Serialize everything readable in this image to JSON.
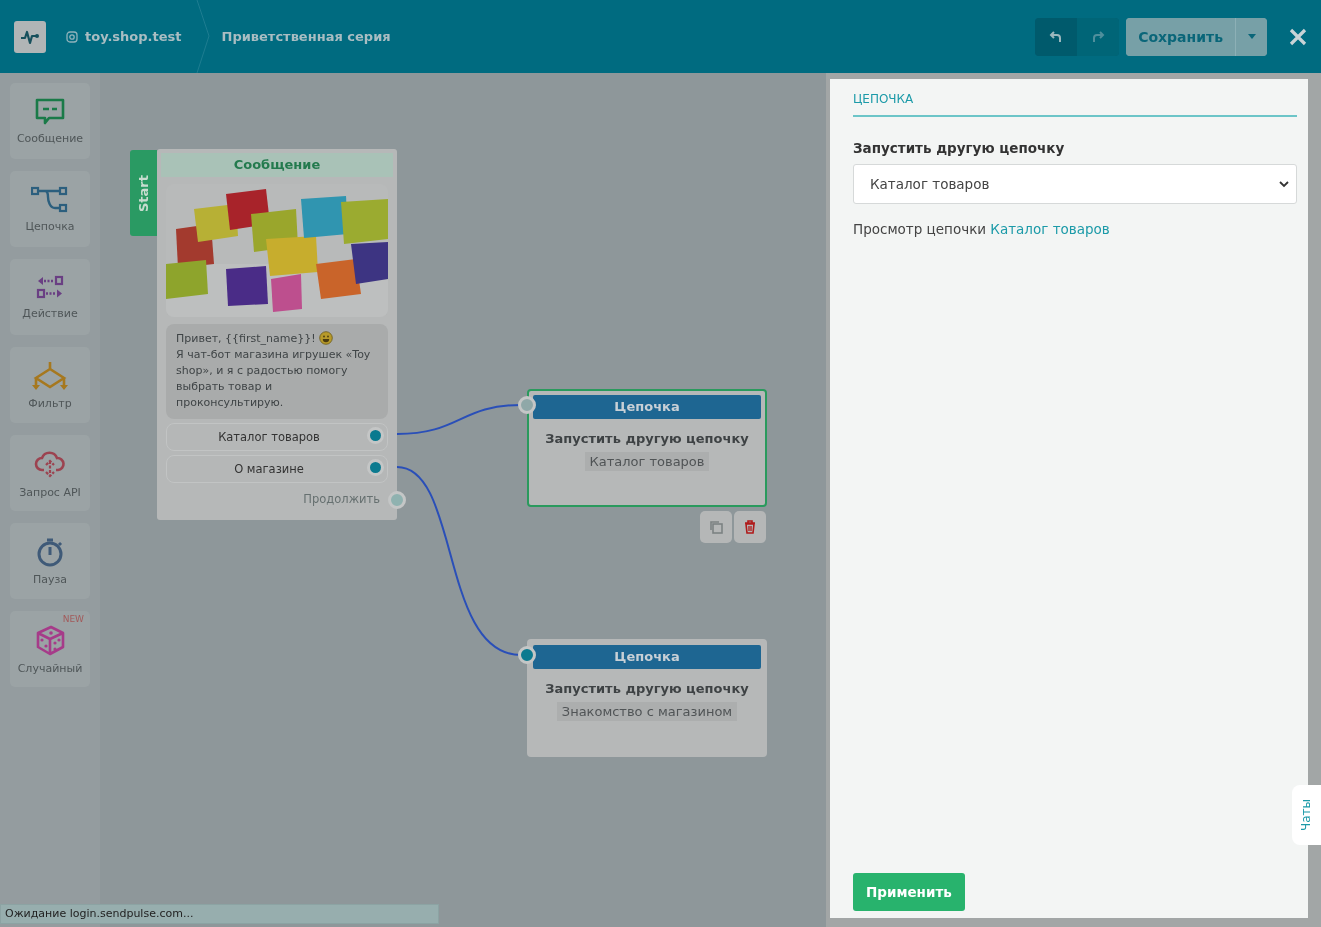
{
  "header": {
    "account": "toy.shop.test",
    "title": "Приветственная серия",
    "save_button": "Сохранить"
  },
  "palette": [
    {
      "label": "Сообщение"
    },
    {
      "label": "Цепочка"
    },
    {
      "label": "Действие"
    },
    {
      "label": "Фильтр"
    },
    {
      "label": "Запрос API"
    },
    {
      "label": "Пауза"
    },
    {
      "label": "Случайный",
      "badge": "NEW"
    }
  ],
  "message_node": {
    "start_label": "Start",
    "title": "Сообщение",
    "greeting": "Привет,  {{first_name}}!",
    "body": "Я чат-бот магазина игрушек «Toy shop», и я с радостью помогу выбрать товар и проконсультирую.",
    "buttons": [
      "Каталог товаров",
      "О магазине"
    ],
    "continue_label": "Продолжить"
  },
  "chain_nodes": [
    {
      "title": "Цепочка",
      "action": "Запустить другую цепочку",
      "target": "Каталог товаров",
      "selected": true
    },
    {
      "title": "Цепочка",
      "action": "Запустить другую цепочку",
      "target": "Знакомство с магазином",
      "selected": false
    }
  ],
  "panel": {
    "tab": "ЦЕПОЧКА",
    "field_label": "Запустить другую цепочку",
    "select_value": "Каталог товаров",
    "view_text": "Просмотр цепочки",
    "view_link": "Каталог товаров",
    "apply_button": "Применить",
    "chats_tab": "Чаты"
  },
  "status_bar": "Ожидание login.sendpulse.com..."
}
